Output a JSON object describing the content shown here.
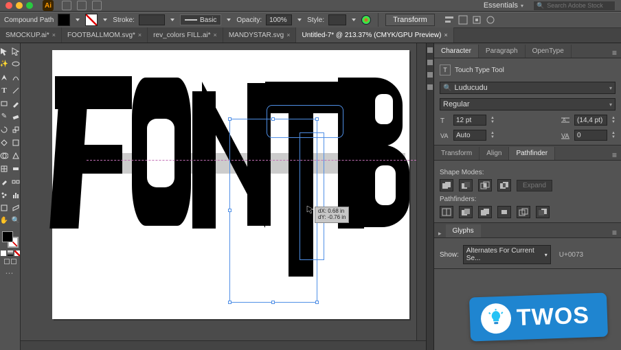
{
  "appbar": {
    "workspace_label": "Essentials",
    "search_placeholder": "Search Adobe Stock"
  },
  "controlbar": {
    "label": "Compound Path",
    "stroke_label": "Stroke:",
    "stroke_value": "",
    "brush_label": "Basic",
    "opacity_label": "Opacity:",
    "opacity_value": "100%",
    "style_label": "Style:",
    "transform_btn": "Transform"
  },
  "tabs": [
    {
      "label": "SMOCKUP.ai*",
      "active": false
    },
    {
      "label": "FOOTBALLMOM.svg*",
      "active": false
    },
    {
      "label": "rev_colors FILL.ai*",
      "active": false
    },
    {
      "label": "MANDYSTAR.svg",
      "active": false
    },
    {
      "label": "Untitled-7* @ 213.37% (CMYK/GPU Preview)",
      "active": true
    }
  ],
  "measure": {
    "dx": "dX: 0.68 in",
    "dy": "dY: -0.76 in"
  },
  "panels": {
    "character": {
      "tabs": [
        "Character",
        "Paragraph",
        "OpenType"
      ],
      "active": "Character",
      "touch_tool": "Touch Type Tool",
      "font_family": "Luducudu",
      "font_style": "Regular",
      "font_size": "12 pt",
      "leading": "(14,4 pt)",
      "kerning": "Auto",
      "tracking": "0"
    },
    "pathfinder": {
      "tabs": [
        "Transform",
        "Align",
        "Pathfinder"
      ],
      "active": "Pathfinder",
      "shape_modes_label": "Shape Modes:",
      "expand_label": "Expand",
      "pathfinders_label": "Pathfinders:"
    },
    "glyphs": {
      "title": "Glyphs",
      "show_label": "Show:",
      "show_value": "Alternates For Current Se...",
      "unicode": "U+0073"
    }
  },
  "sticker": {
    "word": "TWOS"
  }
}
